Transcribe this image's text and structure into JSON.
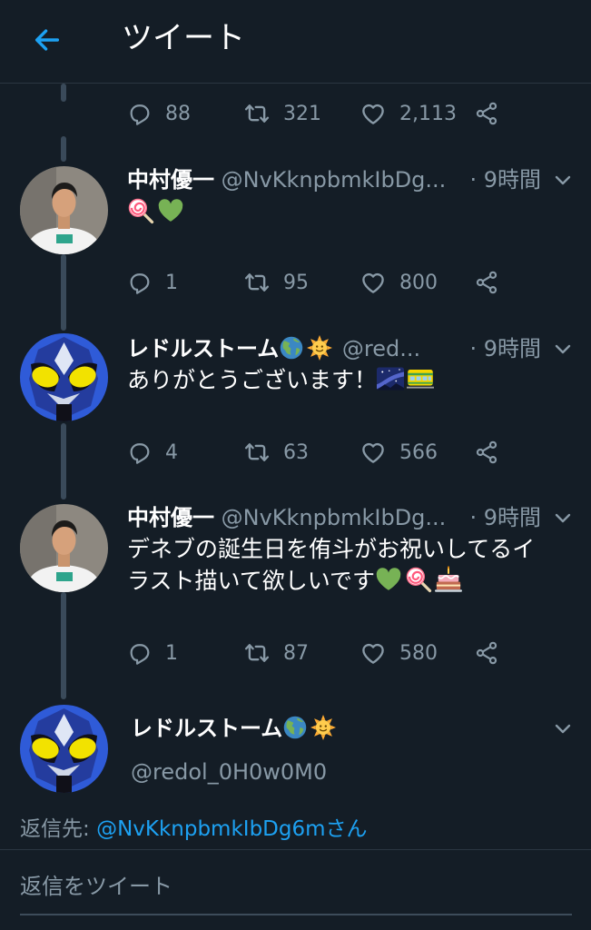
{
  "header": {
    "title": "ツイート"
  },
  "tweets": [
    {
      "stats": {
        "replies": "88",
        "retweets": "321",
        "likes": "2,113"
      }
    },
    {
      "name": "中村優一",
      "handle": "@NvKknpbmkIbDg...",
      "time": "· 9時間",
      "text": "",
      "emoji": [
        "lollipop",
        "green-heart"
      ],
      "avatar": "person-photo",
      "stats": {
        "replies": "1",
        "retweets": "95",
        "likes": "800"
      }
    },
    {
      "name": "レドルストーム",
      "name_emoji": [
        "globe-americas",
        "sun-with-face"
      ],
      "handle": "@red...",
      "time": "· 9時間",
      "text": "ありがとうございます！",
      "emoji": [
        "milky-way",
        "train-car"
      ],
      "avatar": "masked-hero",
      "stats": {
        "replies": "4",
        "retweets": "63",
        "likes": "566"
      }
    },
    {
      "name": "中村優一",
      "handle": "@NvKknpbmkIbDg...",
      "time": "· 9時間",
      "text_line1": "デネブの誕生日を侑斗がお祝いしてるイ",
      "text_line2": "ラスト描いて欲しいです",
      "emoji": [
        "green-heart",
        "lollipop",
        "birthday-cake"
      ],
      "avatar": "person-photo",
      "stats": {
        "replies": "1",
        "retweets": "87",
        "likes": "580"
      }
    }
  ],
  "composer": {
    "name": "レドルストーム",
    "name_emoji": [
      "globe-americas",
      "sun-with-face"
    ],
    "handle": "@redol_0H0w0M0",
    "reply_to_label": "返信先: ",
    "reply_to_mention": "@NvKknpbmkIbDg6m",
    "reply_to_suffix": "さん",
    "placeholder": "返信をツイート"
  },
  "colors": {
    "background": "#141d26",
    "accent": "#1da1f2",
    "muted": "#8899a6",
    "divider": "#2b3641"
  }
}
